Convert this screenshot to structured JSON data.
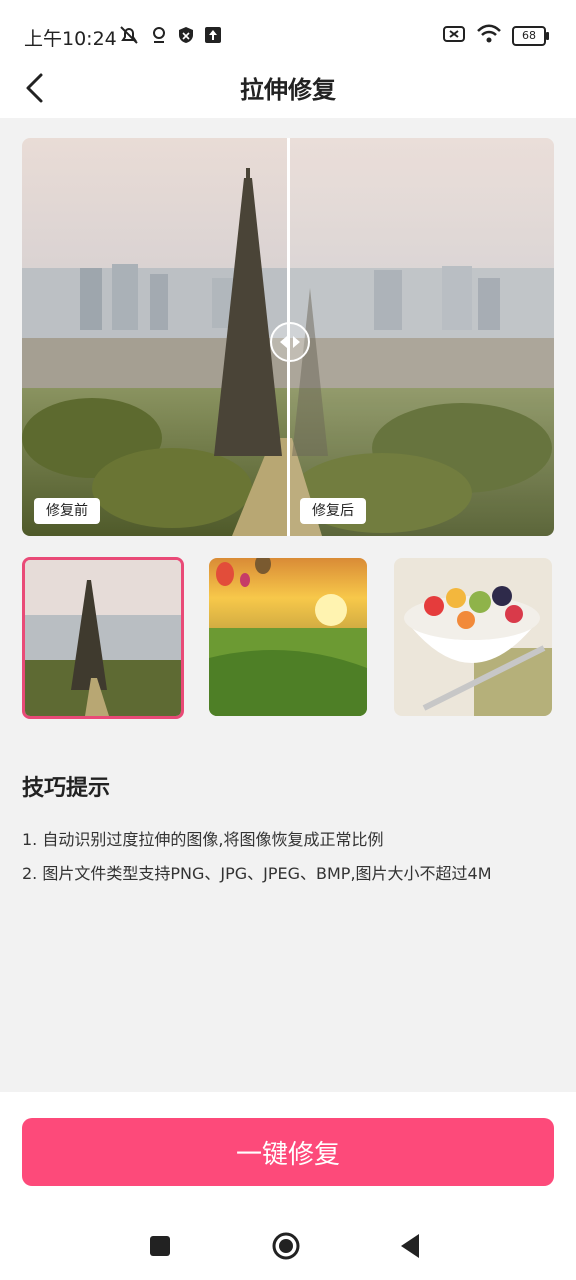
{
  "status_bar": {
    "time": "上午10:24",
    "battery": "68"
  },
  "header": {
    "title": "拉伸修复"
  },
  "preview": {
    "before_label": "修复前",
    "after_label": "修复后"
  },
  "tips": {
    "title": "技巧提示",
    "items": [
      "1. 自动识别过度拉伸的图像,将图像恢复成正常比例",
      "2. 图片文件类型支持PNG、JPG、JPEG、BMP,图片大小不超过4M"
    ]
  },
  "action": {
    "label": "一键修复"
  },
  "colors": {
    "accent": "#fd4a7a",
    "selected_border": "#e94a77"
  }
}
